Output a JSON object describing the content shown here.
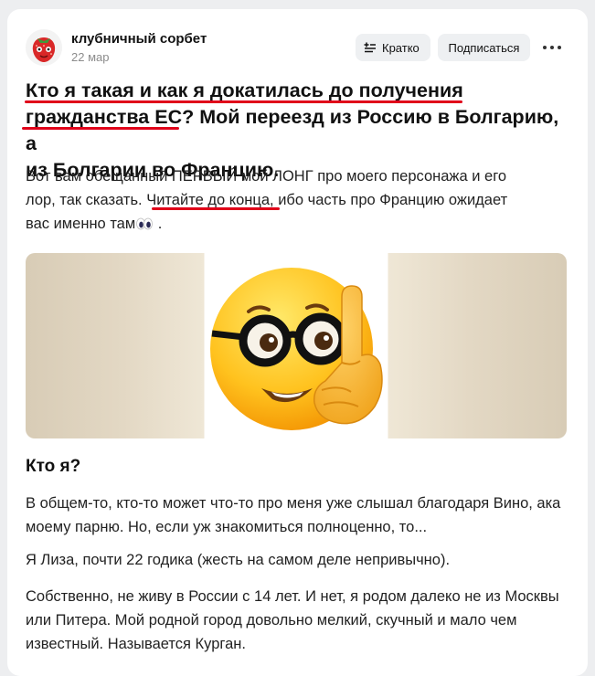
{
  "post": {
    "author": "клубничный сорбет",
    "date": "22 мар",
    "brief_label": "Кратко",
    "subscribe_label": "Подписаться",
    "title": {
      "line1": "Кто я такая и как я докатилась до получения",
      "line2_a": "гражданства ЕС",
      "line2_b": "? Мой переезд из Россию в Болгарию, а",
      "line3": "из Болгарии во Францию."
    },
    "lead": {
      "line1": "Вот вам обещанный ПЕРВЫЙ мой ЛОНГ про моего персонажа и его",
      "line2_a": "лор, так сказать. ",
      "line2_b": "Читайте до конца",
      "line2_c": ", ибо часть про Францию ожидает",
      "line3_a": "вас именно там",
      "line3_b": " ."
    },
    "section_heading": "Кто я?",
    "paragraphs": {
      "p1": "В общем-то, кто-то может что-то про меня уже слышал благодаря Вино, ака моему парню. Но, если уж знакомиться полноценно, то...",
      "p2": "Я Лиза, почти 22 годика (жесть на самом деле непривычно).",
      "p3": "Собственно, не живу в России с 14 лет. И нет, я родом далеко не из Москвы или Питера. Мой родной город довольно мелкий, скучный и мало чем известный. Называется Курган."
    }
  },
  "colors": {
    "accent_underline": "#e0001a",
    "button_bg": "#eef0f2"
  },
  "icons": {
    "avatar": "strawberry-character",
    "brief": "summary-lines-icon",
    "more": "more-dots-icon",
    "image": "nerd-face-emoji"
  }
}
